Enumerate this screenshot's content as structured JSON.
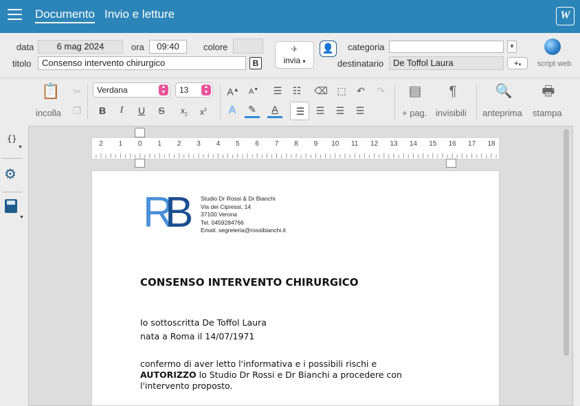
{
  "header": {
    "tabs": [
      {
        "label": "Documento"
      },
      {
        "label": "Invio e letture"
      }
    ],
    "logo_letter": "W"
  },
  "fields": {
    "data_label": "data",
    "data_value": "6 mag 2024",
    "ora_label": "ora",
    "ora_value": "09:40",
    "colore_label": "colore",
    "titolo_label": "titolo",
    "titolo_value": "Consenso intervento chirurgico",
    "bold_button": "B",
    "invia_label": "invia",
    "categoria_label": "categoria",
    "categoria_value": "",
    "destinatario_label": "destinatario",
    "destinatario_value": "De Toffol Laura",
    "plus_label": "+",
    "scriptweb_label": "script web"
  },
  "toolbar": {
    "incolla_label": "incolla",
    "font_family": "Verdana",
    "font_size": "13",
    "pag_label": "+ pag.",
    "invisibili_label": "invisibili",
    "anteprima_label": "anteprima",
    "stampa_label": "stampa"
  },
  "ruler": {
    "numbers": [
      "2",
      "1",
      "0",
      "1",
      "2",
      "3",
      "4",
      "5",
      "6",
      "7",
      "8",
      "9",
      "10",
      "11",
      "12",
      "13",
      "14",
      "15",
      "16",
      "17",
      "18"
    ]
  },
  "document": {
    "letterhead": {
      "logo": "RB",
      "lines": [
        "Studio Dr Rossi & Dr Bianchi",
        "Via dei Cipressi, 14",
        "37100 Verona",
        "Tel. 0459284766",
        "Email. segreteria@rossibianchi.it"
      ]
    },
    "title": "CONSENSO INTERVENTO CHIRURGICO",
    "line1": "Io sottoscritta De Toffol Laura",
    "line2": "nata a Roma il 14/07/1971",
    "line3": "confermo di aver letto l'informativa e i possibili rischi  e",
    "line4_bold": "AUTORIZZO",
    "line4_rest": " lo Studio Dr Rossi e Dr Bianchi a procedere con",
    "line5": "l'intervento proposto."
  },
  "colors": {
    "topbar": "#2c85b8",
    "logo_light": "#4a90d9",
    "logo_dark": "#1b4f8f",
    "accent_pink": "#e8559a",
    "highlight_blue": "#2d8ad8"
  }
}
